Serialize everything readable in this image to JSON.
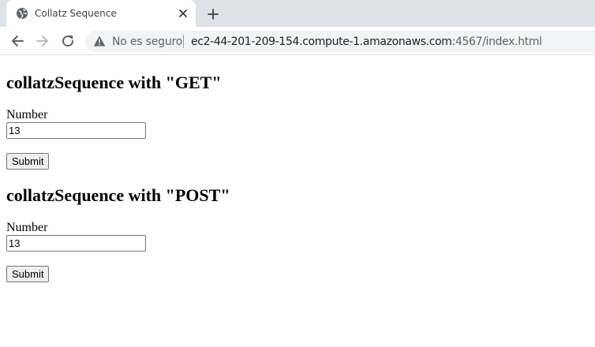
{
  "browser": {
    "tab_title": "Collatz Sequence",
    "security_label": "No es seguro",
    "url_host": "ec2-44-201-209-154.compute-1.amazonaws.com",
    "url_rest": ":4567/index.html"
  },
  "get_form": {
    "heading": "collatzSequence with \"GET\"",
    "label": "Number",
    "value": "13",
    "submit_label": "Submit"
  },
  "post_form": {
    "heading": "collatzSequence with \"POST\"",
    "label": "Number",
    "value": "13",
    "submit_label": "Submit"
  },
  "colors": {
    "tabstrip_bg": "#dee1e6",
    "omnibox_bg": "#f1f3f4",
    "icon_gray": "#5f6368"
  },
  "icons": {
    "favicon": "globe-icon",
    "tab_close": "close-icon",
    "new_tab": "plus-icon",
    "back": "arrow-left-icon",
    "forward": "arrow-right-icon",
    "reload": "reload-icon",
    "security": "warning-icon"
  }
}
